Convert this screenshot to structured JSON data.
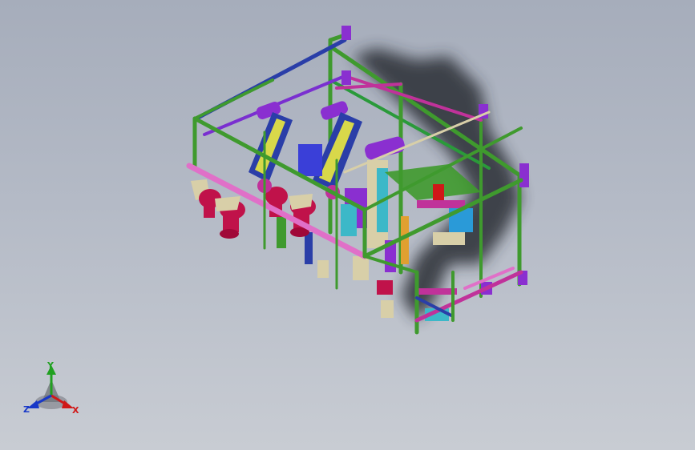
{
  "viewport": {
    "background_top": "#a6adbb",
    "background_bottom": "#c8ccd3"
  },
  "model": {
    "icon": "cad-assembly-machine-frame",
    "colors": {
      "frame_green": "#3f9a2e",
      "frame_blue": "#2a3ea8",
      "frame_magenta": "#c0329a",
      "frame_pink": "#e070c8",
      "frame_purple": "#8a2fd0",
      "part_crimson": "#c0124a",
      "part_yellow": "#d8d84a",
      "part_tan": "#d8cfa8",
      "part_cyan": "#3cb8c8",
      "shadow": "#2c2f36"
    }
  },
  "triad": {
    "icon": "coordinate-triad-icon",
    "x_label": "X",
    "y_label": "Y",
    "z_label": "Z",
    "x_color": "#d01818",
    "y_color": "#20a020",
    "z_color": "#1838c8"
  }
}
